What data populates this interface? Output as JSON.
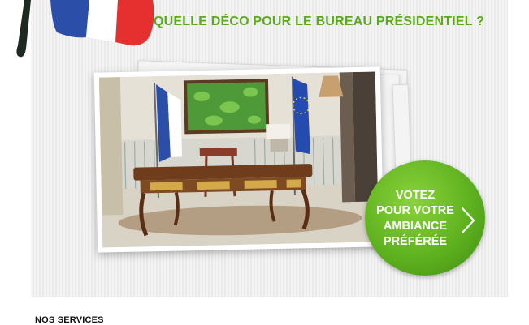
{
  "headline": {
    "text": "QUELLE DÉCO POUR LE BUREAU PRÉSIDENTIEL ?",
    "color": "#5aaa1e"
  },
  "vote_button": {
    "lines": [
      "VOTEZ",
      "POUR VOTRE",
      "AMBIANCE",
      "PRÉFÉRÉE"
    ],
    "color": "#5fb21f"
  },
  "section": {
    "title": "NOS SERVICES"
  },
  "icons": {
    "flag": "french-flag-icon",
    "chevron": "chevron-right-icon"
  },
  "colors": {
    "banner_bg": "#eeeeee",
    "flag_blue": "#2b4fa8",
    "flag_red": "#e63030"
  }
}
